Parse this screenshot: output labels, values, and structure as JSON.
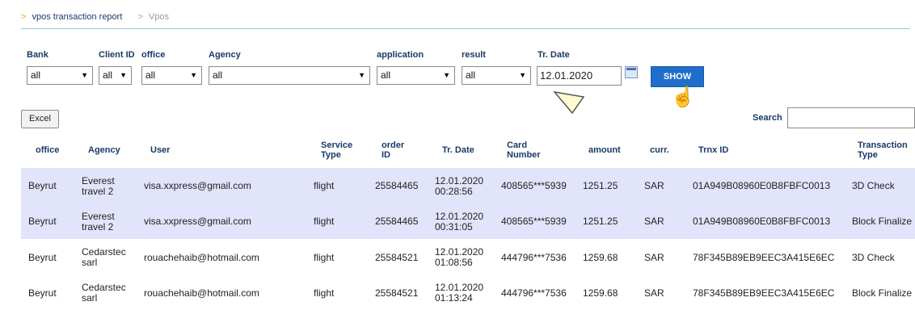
{
  "breadcrumb": {
    "arrow": ">",
    "item1": "vpos transaction report",
    "sep": ">",
    "item2": "Vpos"
  },
  "filters": {
    "bank": {
      "label": "Bank",
      "value": "all"
    },
    "client_id": {
      "label": "Client ID",
      "value": "all"
    },
    "office": {
      "label": "office",
      "value": "all"
    },
    "agency": {
      "label": "Agency",
      "value": "all"
    },
    "application": {
      "label": "application",
      "value": "all"
    },
    "result": {
      "label": "result",
      "value": "all"
    },
    "tr_date": {
      "label": "Tr. Date",
      "value": "12.01.2020"
    },
    "caret": "▼"
  },
  "show_button": "SHOW",
  "excel_button": "Excel",
  "search": {
    "label": "Search",
    "value": ""
  },
  "table": {
    "headers": {
      "office": "office",
      "agency": "Agency",
      "user": "User",
      "service_l1": "Service",
      "service_l2": "Type",
      "order_l1": "order",
      "order_l2": "ID",
      "trdate": "Tr. Date",
      "card_l1": "Card",
      "card_l2": "Number",
      "amount": "amount",
      "curr": "curr.",
      "trnx": "Trnx ID",
      "ttype_l1": "Transaction",
      "ttype_l2": "Type"
    },
    "rows": [
      {
        "office": "Beyrut",
        "agency1": "Everest",
        "agency2": "travel 2",
        "user": "visa.xxpress@gmail.com",
        "service": "flight",
        "order": "25584465",
        "date1": "12.01.2020",
        "date2": "00:28:56",
        "card": "408565***5939",
        "amount": "1251.25",
        "curr": "SAR",
        "trnx": "01A949B08960E0B8FBFC0013",
        "ttype": "3D Check"
      },
      {
        "office": "Beyrut",
        "agency1": "Everest",
        "agency2": "travel 2",
        "user": "visa.xxpress@gmail.com",
        "service": "flight",
        "order": "25584465",
        "date1": "12.01.2020",
        "date2": "00:31:05",
        "card": "408565***5939",
        "amount": "1251.25",
        "curr": "SAR",
        "trnx": "01A949B08960E0B8FBFC0013",
        "ttype": "Block Finalize"
      },
      {
        "office": "Beyrut",
        "agency1": "Cedarstec",
        "agency2": "sarl",
        "user": "rouachehaib@hotmail.com",
        "service": "flight",
        "order": "25584521",
        "date1": "12.01.2020",
        "date2": "01:08:56",
        "card": "444796***7536",
        "amount": "1259.68",
        "curr": "SAR",
        "trnx": "78F345B89EB9EEC3A415E6EC",
        "ttype": "3D Check"
      },
      {
        "office": "Beyrut",
        "agency1": "Cedarstec",
        "agency2": "sarl",
        "user": "rouachehaib@hotmail.com",
        "service": "flight",
        "order": "25584521",
        "date1": "12.01.2020",
        "date2": "01:13:24",
        "card": "444796***7536",
        "amount": "1259.68",
        "curr": "SAR",
        "trnx": "78F345B89EB9EEC3A415E6EC",
        "ttype": "Block Finalize"
      }
    ]
  }
}
